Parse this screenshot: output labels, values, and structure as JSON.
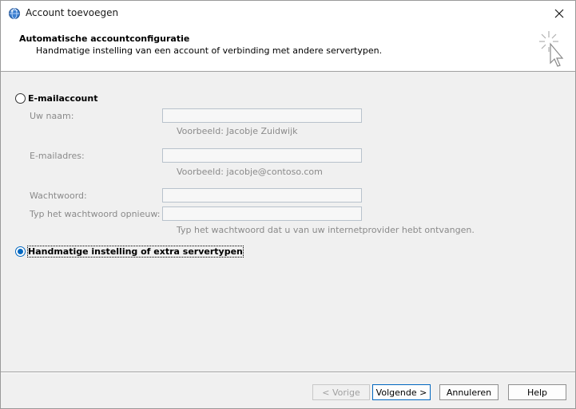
{
  "window": {
    "title": "Account toevoegen",
    "icon": "outlook-globe-icon"
  },
  "header": {
    "title": "Automatische accountconfiguratie",
    "subtitle": "Handmatige instelling van een account of verbinding met andere servertypen.",
    "icon": "wizard-cursor-icon"
  },
  "options": {
    "email_account": {
      "label": "E-mailaccount",
      "selected": false
    },
    "manual_setup": {
      "label": "Handmatige instelling of extra servertypen",
      "selected": true
    }
  },
  "fields": {
    "name": {
      "label": "Uw naam:",
      "value": "",
      "hint": "Voorbeeld: Jacobje Zuidwijk"
    },
    "email": {
      "label": "E-mailadres:",
      "value": "",
      "hint": "Voorbeeld: jacobje@contoso.com"
    },
    "password": {
      "label": "Wachtwoord:",
      "value": ""
    },
    "password_repeat": {
      "label": "Typ het wachtwoord opnieuw:",
      "value": "",
      "hint": "Typ het wachtwoord dat u van uw internetprovider hebt ontvangen."
    }
  },
  "buttons": {
    "back": "< Vorige",
    "next": "Volgende >",
    "cancel": "Annuleren",
    "help": "Help"
  },
  "colors": {
    "accent": "#0067c0",
    "disabled_text": "#8a8a8a"
  }
}
